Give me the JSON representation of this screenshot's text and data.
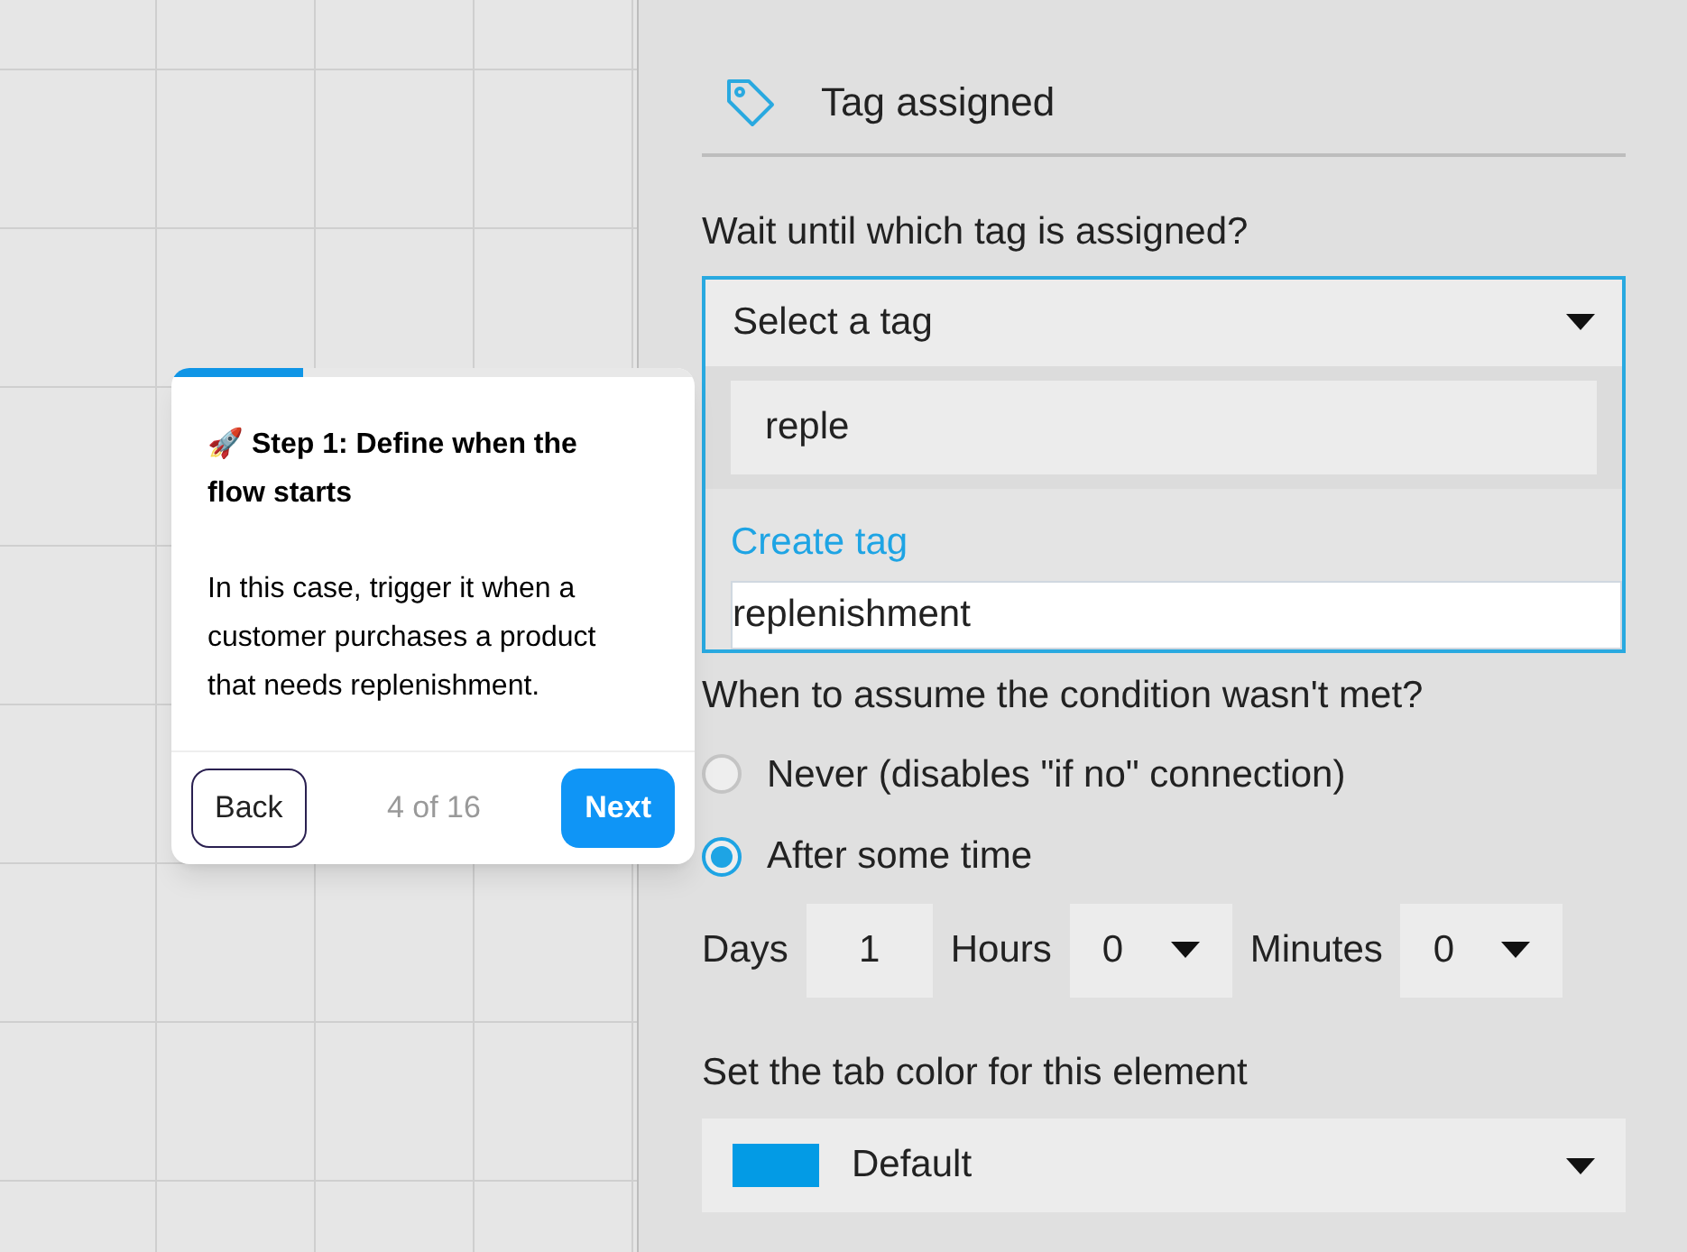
{
  "panel": {
    "title": "Tag assigned",
    "tag_question": "Wait until which tag is assigned?",
    "tag_select": {
      "placeholder": "Select a tag",
      "expanded": true,
      "search_value": "reple",
      "create_label": "Create tag",
      "options": [
        {
          "label": "replenishment",
          "selected": true
        }
      ]
    },
    "timeout_question": "When to assume the condition wasn't met?",
    "timeout_options": [
      {
        "label": "Never (disables \"if no\" connection)",
        "selected": false
      },
      {
        "label": "After some time",
        "selected": true
      }
    ],
    "duration": [
      {
        "kind": "input",
        "label": "Days",
        "value": "1"
      },
      {
        "kind": "select",
        "label": "Hours",
        "value": "0"
      },
      {
        "kind": "select",
        "label": "Minutes",
        "value": "0"
      }
    ],
    "color_question": "Set the tab color for this element",
    "color_select": {
      "value": "Default",
      "color": "#039be5"
    }
  },
  "tour": {
    "level": 0.25,
    "title": "🚀 Step 1: Define when the flow starts",
    "body": "In this case, trigger it when a customer purchases a product that needs replenishment.",
    "back": "Back",
    "progress": "4 of 16",
    "next": "Next"
  }
}
